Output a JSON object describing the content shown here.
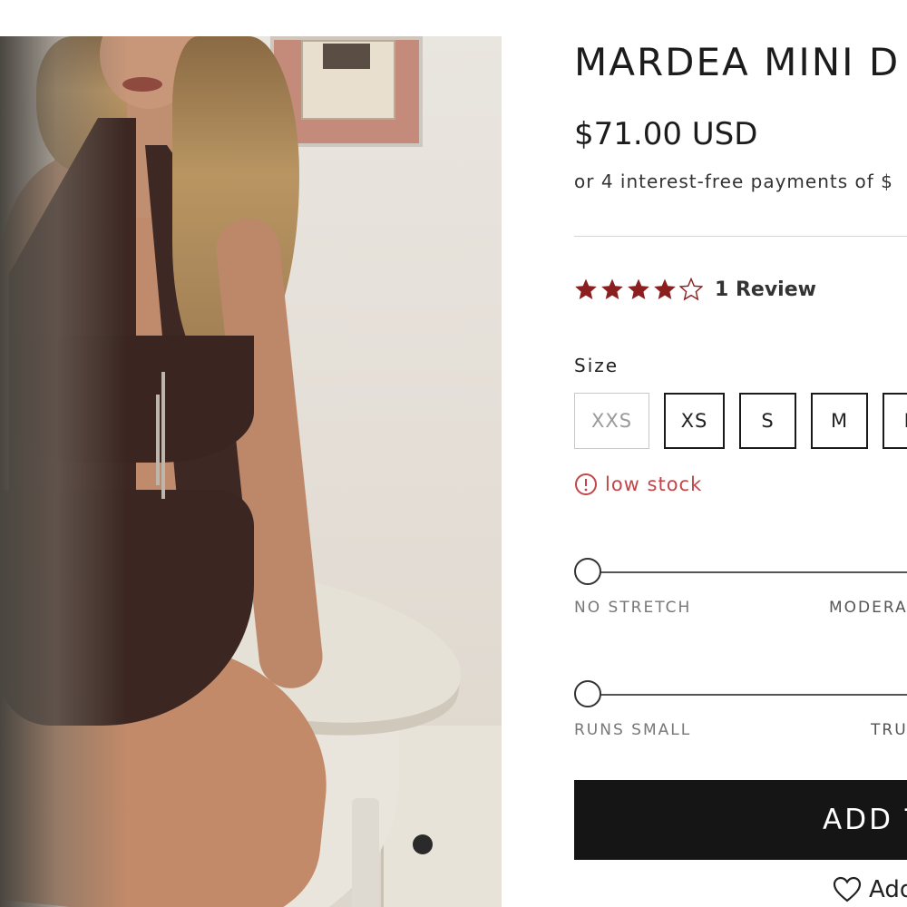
{
  "product": {
    "title": "MARDEA MINI D",
    "price": "$71.00 USD",
    "installments_text": "or 4 interest-free payments of $",
    "rating": {
      "value": 4,
      "max": 5,
      "reviews_label": "1 Review",
      "star_color": "#8b1e1e"
    },
    "size": {
      "label": "Size",
      "options": [
        {
          "label": "XXS",
          "available": false
        },
        {
          "label": "XS",
          "available": true
        },
        {
          "label": "S",
          "available": true
        },
        {
          "label": "M",
          "available": true
        },
        {
          "label": "L",
          "available": true
        }
      ]
    },
    "stock": {
      "text": "low stock",
      "icon": "alert-circle-icon",
      "color": "#c0464a"
    },
    "stretch_scale": {
      "left_label": "NO STRETCH",
      "mid_label": "MODERA",
      "value": 0
    },
    "fit_scale": {
      "left_label": "RUNS SMALL",
      "mid_label": "TRU",
      "value": 0
    },
    "add_to_cart_label": "ADD T",
    "wishlist_label": "Add",
    "wishlist_icon": "heart-icon"
  },
  "image": {
    "alt_subject": "product photo"
  }
}
